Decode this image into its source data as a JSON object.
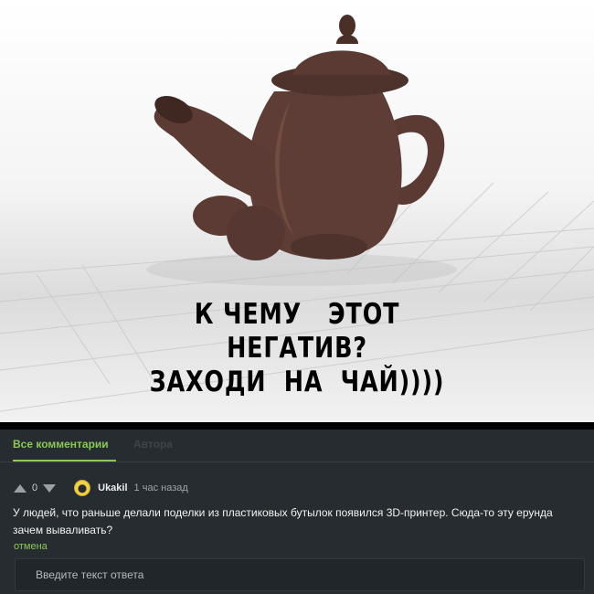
{
  "meme": {
    "caption_lines": [
      "К ЧЕМУ   ЭТОТ",
      "НЕГАТИВ?",
      "ЗАХОДИ  НА  ЧАЙ))))"
    ]
  },
  "comments": {
    "tabs": [
      {
        "label": "Все комментарии",
        "active": true
      },
      {
        "label": "Автора",
        "active": false
      }
    ],
    "comment": {
      "votes": "0",
      "username": "Ukakil",
      "timestamp": "1 час назад",
      "text": "У людей, что раньше делали поделки из пластиковых бутылок появился 3D-принтер. Сюда-то эту ерунда зачем вываливать?",
      "cancel_label": "отмена"
    },
    "reply": {
      "placeholder": "Введите текст ответа",
      "value": ""
    }
  },
  "colors": {
    "accent": "#8ac858",
    "panel_bg": "#262c30",
    "input_bg": "#20262a"
  },
  "icons": [
    "upvote-arrow-icon",
    "downvote-arrow-icon",
    "avatar-icon"
  ]
}
